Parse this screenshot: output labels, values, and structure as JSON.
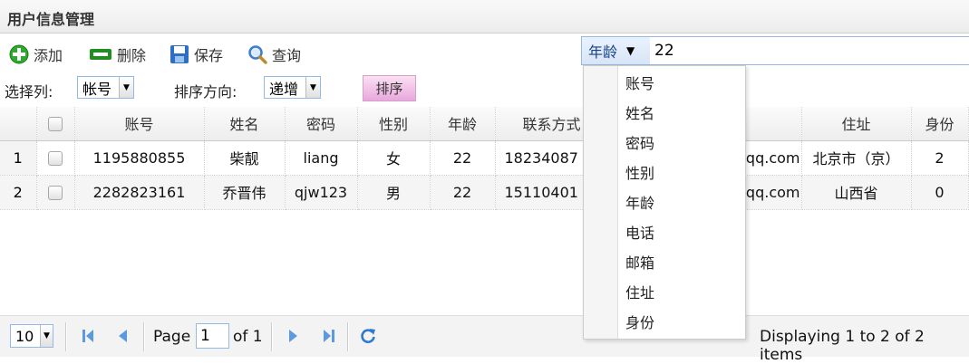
{
  "panel": {
    "title": "用户信息管理"
  },
  "toolbar": {
    "add": "添加",
    "delete": "删除",
    "save": "保存",
    "query": "查询"
  },
  "filter": {
    "select_column_label": "选择列:",
    "select_column_value": "帐号",
    "sort_direction_label": "排序方向:",
    "sort_direction_value": "递增",
    "sort_button": "排序"
  },
  "search": {
    "field": "年龄",
    "value": "22",
    "menu_items": [
      "账号",
      "姓名",
      "密码",
      "性别",
      "年龄",
      "电话",
      "邮箱",
      "住址",
      "身份"
    ]
  },
  "grid": {
    "columns": [
      "账号",
      "姓名",
      "密码",
      "性别",
      "年龄",
      "联系方式",
      "",
      "住址",
      "身份"
    ],
    "rows": [
      {
        "rownum": "1",
        "cells": [
          "1195880855",
          "柴靓",
          "liang",
          "女",
          "22",
          "18234087",
          "qq.com",
          "北京市（京）",
          "2"
        ]
      },
      {
        "rownum": "2",
        "cells": [
          "2282823161",
          "乔晋伟",
          "qjw123",
          "男",
          "22",
          "15110401",
          "qq.com",
          "山西省",
          "0"
        ]
      }
    ]
  },
  "pager": {
    "page_size": "10",
    "page_label": "Page",
    "page_value": "1",
    "of_label": "of 1",
    "display_info": "Displaying 1 to 2 of 2 items"
  },
  "colors": {
    "accent": "#15428b",
    "border": "#95b8e7",
    "sort_button": "#e8a8dc",
    "add_icon": "#2ea82e",
    "delete_icon": "#1f8f1f"
  }
}
